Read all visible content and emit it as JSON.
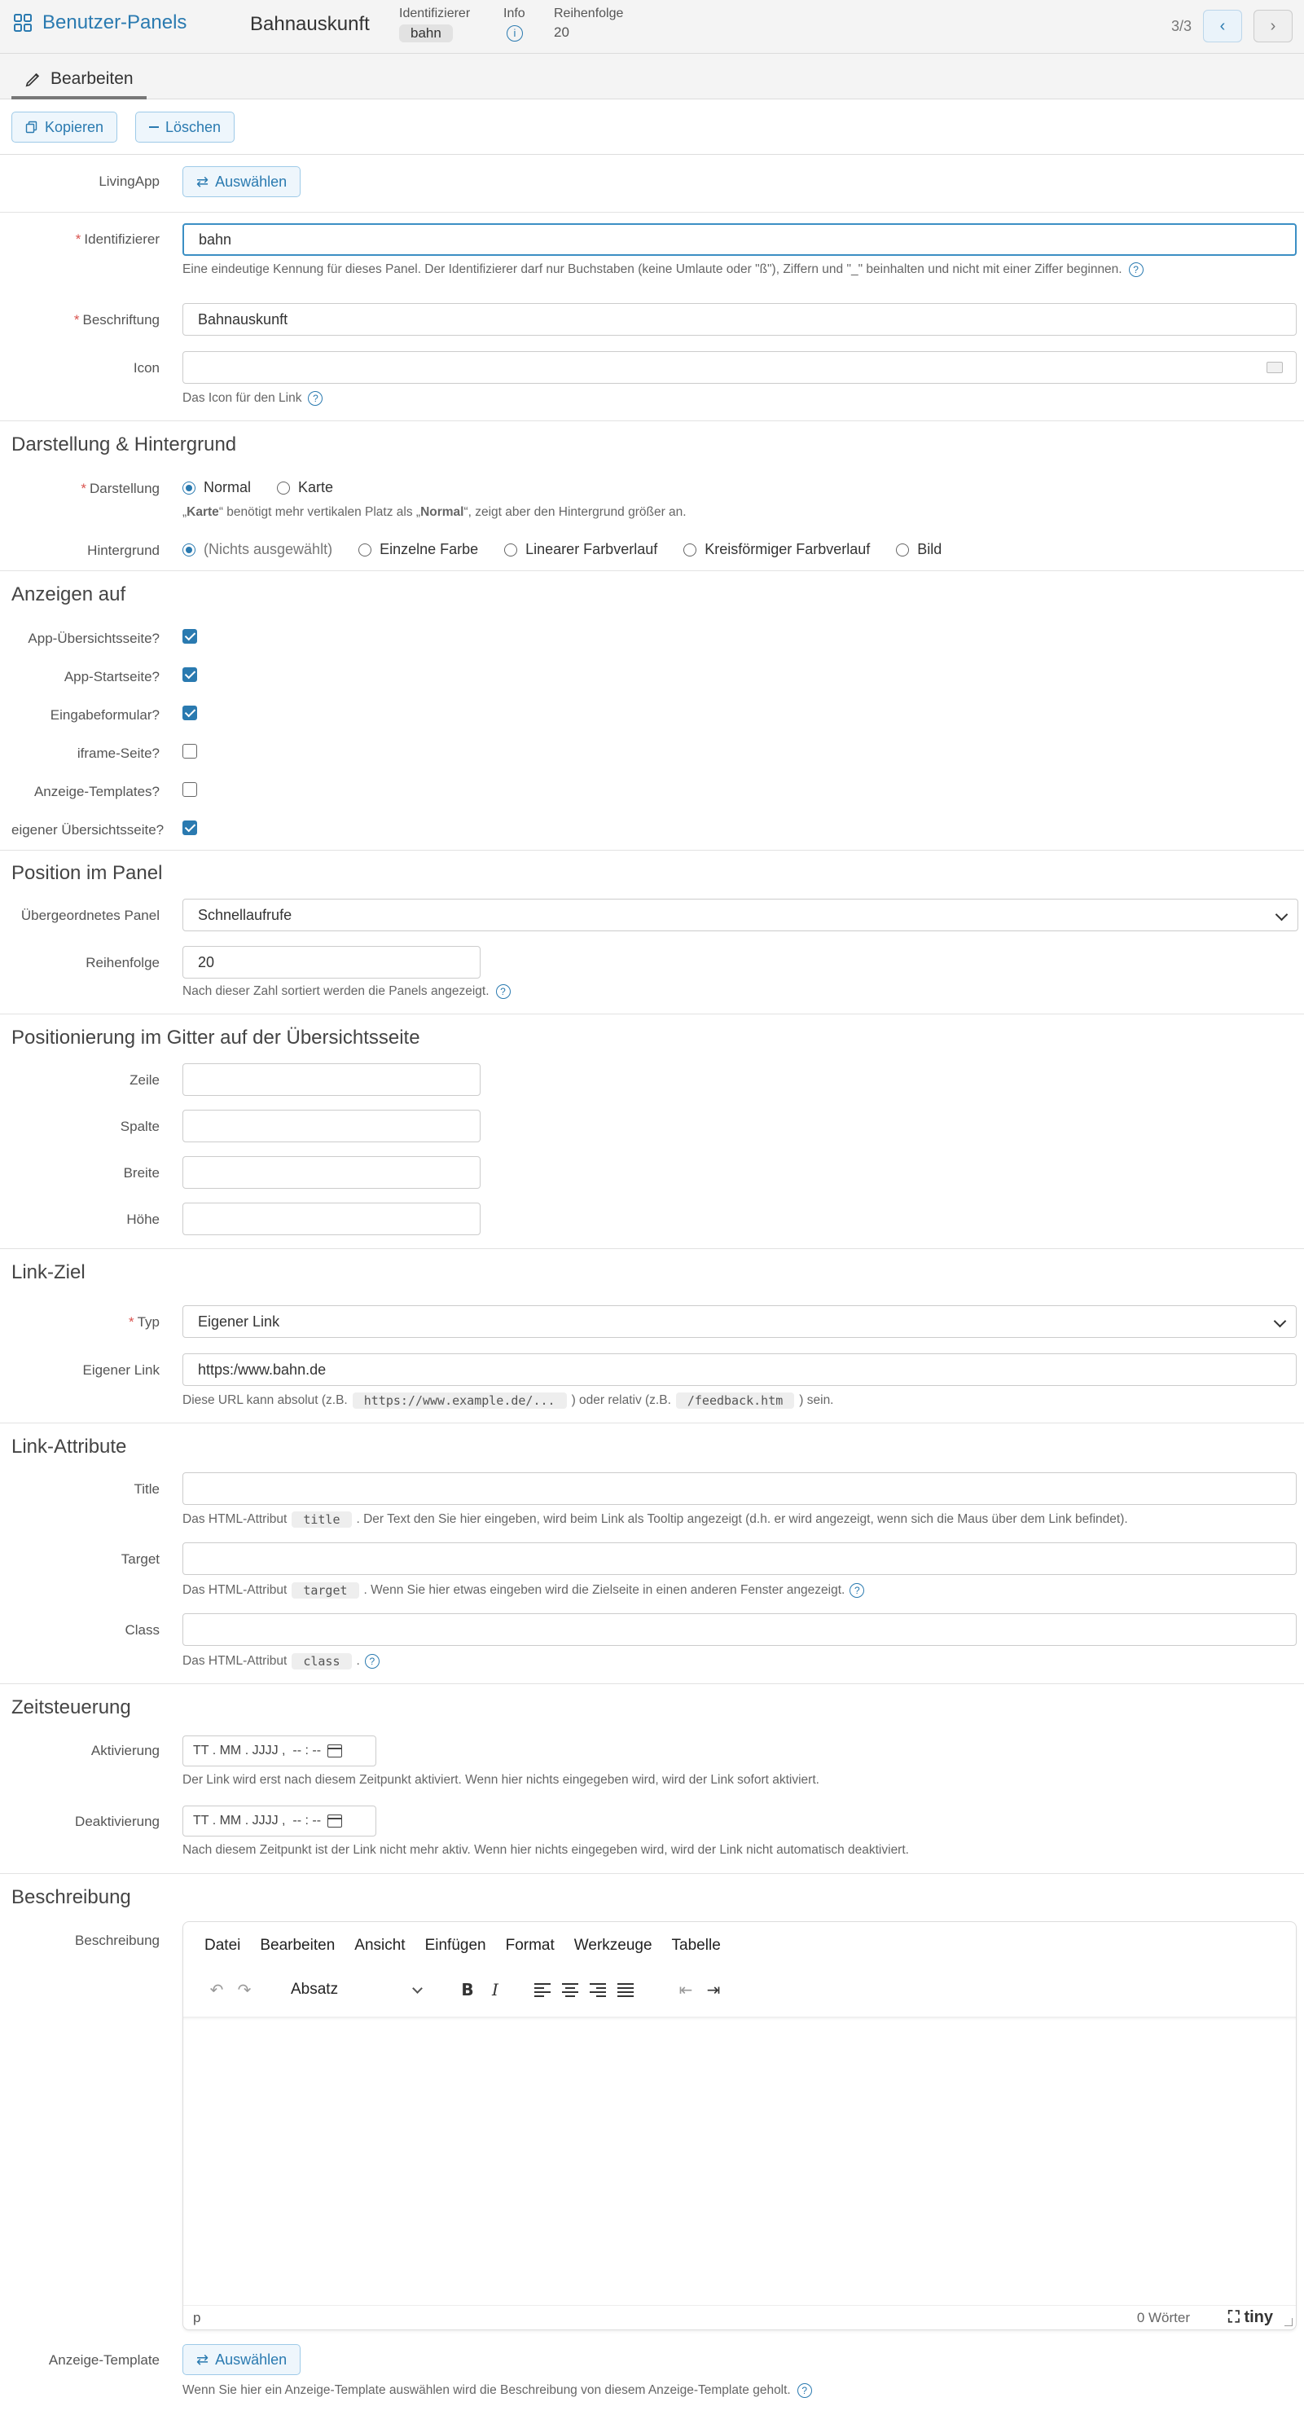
{
  "header": {
    "brand": "Benutzer-Panels",
    "title": "Bahnauskunft",
    "identifier_label": "Identifizierer",
    "identifier_value": "bahn",
    "info_label": "Info",
    "order_label": "Reihenfolge",
    "order_value": "20",
    "pager": "3/3"
  },
  "tabs": {
    "edit": "Bearbeiten"
  },
  "toolbar": {
    "copy": "Kopieren",
    "delete": "Löschen"
  },
  "form": {
    "livingapp_label": "LivingApp",
    "select_button": "Auswählen",
    "identifier_label": "Identifizierer",
    "identifier_value": "bahn",
    "identifier_help": "Eine eindeutige Kennung für dieses Panel. Der Identifizierer darf nur Buchstaben (keine Umlaute oder \"ß\"), Ziffern und \"_\" beinhalten und nicht mit einer Ziffer beginnen.",
    "caption_label": "Beschriftung",
    "caption_value": "Bahnauskunft",
    "icon_label": "Icon",
    "icon_help": "Das Icon für den Link"
  },
  "display": {
    "title": "Darstellung & Hintergrund",
    "mode_label": "Darstellung",
    "mode_normal": "Normal",
    "mode_card": "Karte",
    "mode_help_pre": "„",
    "mode_help_card": "Karte",
    "mode_help_mid": "“ benötigt mehr vertikalen Platz als „",
    "mode_help_normal": "Normal",
    "mode_help_post": "“, zeigt aber den Hintergrund größer an.",
    "bg_label": "Hintergrund",
    "bg_none": "(Nichts ausgewählt)",
    "bg_single": "Einzelne Farbe",
    "bg_linear": "Linearer Farbverlauf",
    "bg_radial": "Kreisförmiger Farbverlauf",
    "bg_image": "Bild"
  },
  "showon": {
    "title": "Anzeigen auf",
    "items": [
      {
        "label": "App-Übersichtsseite?",
        "checked": true
      },
      {
        "label": "App-Startseite?",
        "checked": true
      },
      {
        "label": "Eingabeformular?",
        "checked": true
      },
      {
        "label": "iframe-Seite?",
        "checked": false
      },
      {
        "label": "Anzeige-Templates?",
        "checked": false
      },
      {
        "label": "eigener Übersichtsseite?",
        "checked": true
      }
    ]
  },
  "position": {
    "title": "Position im Panel",
    "parent_label": "Übergeordnetes Panel",
    "parent_value": "Schnellaufrufe",
    "order_label": "Reihenfolge",
    "order_value": "20",
    "order_help": "Nach dieser Zahl sortiert werden die Panels angezeigt."
  },
  "grid": {
    "title": "Positionierung im Gitter auf der Übersichtsseite",
    "row_label": "Zeile",
    "col_label": "Spalte",
    "width_label": "Breite",
    "height_label": "Höhe"
  },
  "link": {
    "title": "Link-Ziel",
    "type_label": "Typ",
    "type_value": "Eigener Link",
    "custom_label": "Eigener Link",
    "custom_value": "https:/www.bahn.de",
    "help_pre": "Diese URL kann absolut (z.B.",
    "help_code1": "https://www.example.de/...",
    "help_mid": ") oder relativ (z.B.",
    "help_code2": "/feedback.htm",
    "help_post": ") sein."
  },
  "attrs": {
    "title": "Link-Attribute",
    "title_label": "Title",
    "title_help_pre": "Das HTML-Attribut",
    "title_help_code": "title",
    "title_help_post": ". Der Text den Sie hier eingeben, wird beim Link als Tooltip angezeigt (d.h. er wird angezeigt, wenn sich die Maus über dem Link befindet).",
    "target_label": "Target",
    "target_help_pre": "Das HTML-Attribut",
    "target_help_code": "target",
    "target_help_post": ". Wenn Sie hier etwas eingeben wird die Zielseite in einen anderen Fenster angezeigt.",
    "class_label": "Class",
    "class_help_pre": "Das HTML-Attribut",
    "class_help_code": "class",
    "class_help_post": "."
  },
  "timing": {
    "title": "Zeitsteuerung",
    "activate_label": "Aktivierung",
    "activate_placeholder": "TT . MM . JJJJ ,  -- : --",
    "activate_help": "Der Link wird erst nach diesem Zeitpunkt aktiviert. Wenn hier nichts eingegeben wird, wird der Link sofort aktiviert.",
    "deactivate_label": "Deaktivierung",
    "deactivate_placeholder": "TT . MM . JJJJ ,  -- : --",
    "deactivate_help": "Nach diesem Zeitpunkt ist der Link nicht mehr aktiv. Wenn hier nichts eingegeben wird, wird der Link nicht automatisch deaktiviert."
  },
  "description": {
    "title": "Beschreibung",
    "label": "Beschreibung",
    "menu": [
      "Datei",
      "Bearbeiten",
      "Ansicht",
      "Einfügen",
      "Format",
      "Werkzeuge",
      "Tabelle"
    ],
    "block_format": "Absatz",
    "status_path": "p",
    "word_count": "0 Wörter",
    "brand": "tiny",
    "template_label": "Anzeige-Template",
    "template_button": "Auswählen",
    "template_help": "Wenn Sie hier ein Anzeige-Template auswählen wird die Beschreibung von diesem Anzeige-Template geholt."
  },
  "colors": {
    "accent": "#2a7ab0",
    "required": "#d9534f"
  }
}
